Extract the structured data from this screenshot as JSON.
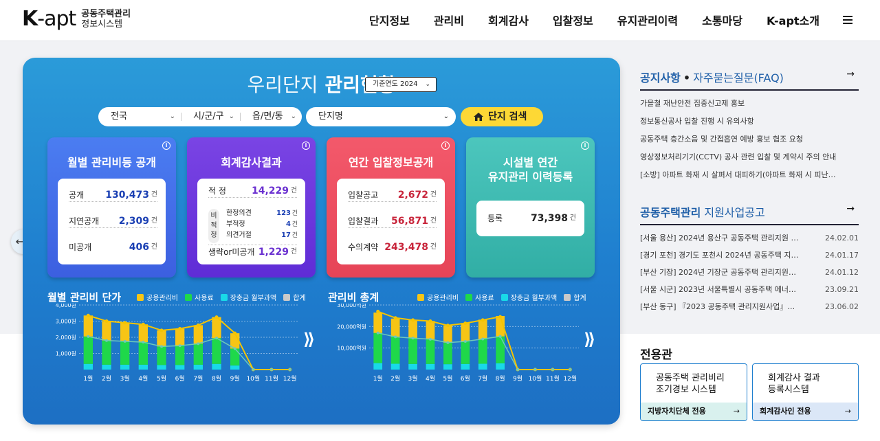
{
  "header": {
    "logo_main": "K",
    "logo_rest": "-apt",
    "logo_sub1": "공동주택관리",
    "logo_sub2": "정보시스템",
    "nav": [
      "단지정보",
      "관리비",
      "회계감사",
      "입찰정보",
      "유지관리이력",
      "소통마당",
      "K-apt소개"
    ]
  },
  "panel": {
    "title_light": "우리단지",
    "title_bold": "관리현황",
    "year_select": "기준연도 2024",
    "search": {
      "sido": "전국",
      "sigungu": "시/군/구",
      "eup": "읍/면/동",
      "complex": "단지명",
      "button": "단지 검색"
    },
    "cards": {
      "mgmt": {
        "title": "월별 관리비등 공개",
        "rows": [
          {
            "label": "공개",
            "value": "130,473",
            "unit": "건"
          },
          {
            "label": "지연공개",
            "value": "2,309",
            "unit": "건"
          },
          {
            "label": "미공개",
            "value": "406",
            "unit": "건"
          }
        ]
      },
      "audit": {
        "title": "회계감사결과",
        "top": {
          "label": "적 정",
          "value": "14,229",
          "unit": "건"
        },
        "pill": "비\n적\n정",
        "sub": [
          {
            "label": "한정의견",
            "value": "123",
            "unit": "건"
          },
          {
            "label": "부적정",
            "value": "4",
            "unit": "건"
          },
          {
            "label": "의견거절",
            "value": "17",
            "unit": "건"
          }
        ],
        "bottom": {
          "label": "생략or미공개",
          "value": "1,229",
          "unit": "건"
        }
      },
      "bid": {
        "title": "연간 입찰정보공개",
        "rows": [
          {
            "label": "입찰공고",
            "value": "2,672",
            "unit": "건"
          },
          {
            "label": "입찰결과",
            "value": "56,871",
            "unit": "건"
          },
          {
            "label": "수의계약",
            "value": "243,478",
            "unit": "건"
          }
        ]
      },
      "facility": {
        "title1": "시설별 연간",
        "title2": "유지관리 이력등록",
        "row": {
          "label": "등록",
          "value": "73,398",
          "unit": "건"
        }
      }
    },
    "legend": [
      "공용관리비",
      "사용료",
      "장충금 월부과액",
      "합계"
    ]
  },
  "colors": {
    "common": "#f7c515",
    "usage": "#1fd84a",
    "reserve": "#19d9e8",
    "total": "#c9c9c9",
    "line_total": "#f5c400",
    "line_usage": "#6fc9b8"
  },
  "chart_data": [
    {
      "type": "bar",
      "title": "월별 관리비 단가",
      "categories": [
        "1월",
        "2월",
        "3월",
        "4월",
        "5월",
        "6월",
        "7월",
        "8월",
        "9월",
        "10월",
        "11월",
        "12월"
      ],
      "ylim": [
        0,
        4000
      ],
      "yticks": [
        "4,000원",
        "3,000원",
        "2,000원",
        "1,000원"
      ],
      "series": [
        {
          "name": "공용관리비",
          "values": [
            1300,
            1200,
            1150,
            1100,
            1000,
            1050,
            1150,
            1300,
            950,
            0,
            0,
            0
          ]
        },
        {
          "name": "사용료",
          "values": [
            1700,
            1500,
            1450,
            1400,
            1150,
            1200,
            1300,
            1600,
            1050,
            0,
            0,
            0
          ]
        },
        {
          "name": "장충금 월부과액",
          "values": [
            350,
            300,
            300,
            300,
            280,
            280,
            300,
            350,
            250,
            0,
            0,
            0
          ]
        },
        {
          "name": "합계",
          "values": [
            3350,
            3000,
            2900,
            2800,
            2430,
            2530,
            2750,
            3250,
            2250,
            0,
            0,
            0
          ]
        }
      ]
    },
    {
      "type": "bar",
      "title": "관리비 총계",
      "categories": [
        "1월",
        "2월",
        "3월",
        "4월",
        "5월",
        "6월",
        "7월",
        "8월",
        "9월",
        "10월",
        "11월",
        "12월"
      ],
      "ylim": [
        0,
        30000
      ],
      "yticks": [
        "30,000억원",
        "20,000억원",
        "10,000억원"
      ],
      "series": [
        {
          "name": "공용관리비",
          "values": [
            9500,
            8500,
            8500,
            8500,
            8000,
            8500,
            9000,
            9500,
            0,
            0,
            0,
            0
          ]
        },
        {
          "name": "사용료",
          "values": [
            14000,
            12500,
            12000,
            11500,
            10000,
            10500,
            11500,
            12500,
            0,
            0,
            0,
            0
          ]
        },
        {
          "name": "장충금 월부과액",
          "values": [
            3000,
            2700,
            2600,
            2600,
            2500,
            2600,
            2700,
            2900,
            0,
            0,
            0,
            0
          ]
        },
        {
          "name": "합계",
          "values": [
            27000,
            24000,
            23000,
            22500,
            20500,
            21500,
            23000,
            24500,
            0,
            0,
            0,
            0
          ]
        }
      ]
    }
  ],
  "side": {
    "notice_tab1": "공지사항",
    "notice_tab2": "자주묻는질문(FAQ)",
    "notices": [
      "가을철 재난안전 집중신고제 홍보",
      "정보통신공사 입찰 진행 시 유의사항",
      "공동주택 층간소음 및 간접흡연 예방 홍보 협조 요청",
      "영상정보처리기기(CCTV) 공사 관련 입찰 및 계약시 주의 안내",
      "[소방] 아파트 화재 시 살펴서 대피하기(아파트 화재 시 피난…"
    ],
    "support_title_bold": "공동주택관리",
    "support_title_light": "지원사업공고",
    "support": [
      {
        "title": "[서울 용산] 2024년 용산구 공동주택 관리지원 …",
        "date": "24.02.01"
      },
      {
        "title": "[경기 포천] 경기도 포천시 2024년 공동주택 지…",
        "date": "24.01.17"
      },
      {
        "title": "[부산 기장] 2024년 기장군 공동주택 관리지원…",
        "date": "24.01.12"
      },
      {
        "title": "[서울 시군] 2023년 서울특별시 공동주택 에너…",
        "date": "23.09.21"
      },
      {
        "title": "[부산 동구] 『2023 공동주택 관리지원사업』…",
        "date": "23.06.02"
      }
    ],
    "dedicated_title": "전용관",
    "dedicated": [
      {
        "line1": "공동주택 관리비리",
        "line2": "조기경보 시스템",
        "footer": "지방자치단체 전용"
      },
      {
        "line1": "회계감사 결과",
        "line2": "등록시스템",
        "footer": "회계감사인 전용"
      }
    ]
  }
}
